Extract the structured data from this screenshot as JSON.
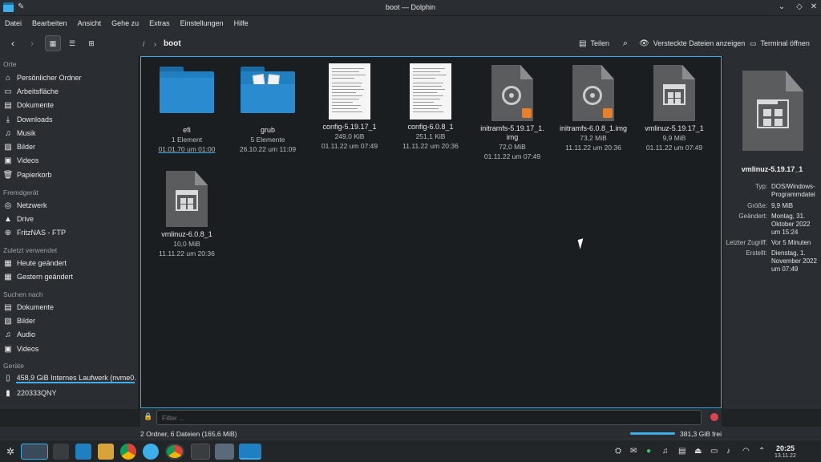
{
  "window": {
    "title": "boot — Dolphin"
  },
  "menu": [
    "Datei",
    "Bearbeiten",
    "Ansicht",
    "Gehe zu",
    "Extras",
    "Einstellungen",
    "Hilfe"
  ],
  "toolbar": {
    "breadcrumb_root": "/",
    "breadcrumb_current": "boot",
    "share_label": "Teilen",
    "hidden_files_label": "Versteckte Dateien anzeigen",
    "terminal_label": "Terminal öffnen"
  },
  "sidebar": {
    "sections": [
      {
        "title": "Orte",
        "items": [
          {
            "icon": "home-icon",
            "label": "Persönlicher Ordner"
          },
          {
            "icon": "desktop-icon",
            "label": "Arbeitsfläche"
          },
          {
            "icon": "documents-icon",
            "label": "Dokumente"
          },
          {
            "icon": "downloads-icon",
            "label": "Downloads"
          },
          {
            "icon": "music-icon",
            "label": "Musik"
          },
          {
            "icon": "pictures-icon",
            "label": "Bilder"
          },
          {
            "icon": "videos-icon",
            "label": "Videos"
          },
          {
            "icon": "trash-icon",
            "label": "Papierkorb"
          }
        ]
      },
      {
        "title": "Fremdgerät",
        "items": [
          {
            "icon": "network-icon",
            "label": "Netzwerk"
          },
          {
            "icon": "drive-icon",
            "label": "Drive"
          },
          {
            "icon": "ftp-icon",
            "label": "FritzNAS - FTP"
          }
        ]
      },
      {
        "title": "Zuletzt verwendet",
        "items": [
          {
            "icon": "recent-icon",
            "label": "Heute geändert"
          },
          {
            "icon": "recent-icon",
            "label": "Gestern geändert"
          }
        ]
      },
      {
        "title": "Suchen nach",
        "items": [
          {
            "icon": "documents-icon",
            "label": "Dokumente"
          },
          {
            "icon": "pictures-icon",
            "label": "Bilder"
          },
          {
            "icon": "audio-icon",
            "label": "Audio"
          },
          {
            "icon": "videos-icon",
            "label": "Videos"
          }
        ]
      },
      {
        "title": "Geräte",
        "items": [
          {
            "icon": "harddisk-icon",
            "label": "458,9 GiB Internes Laufwerk (nvme0..."
          },
          {
            "icon": "phone-icon",
            "label": "220333QNY"
          }
        ]
      }
    ]
  },
  "files": [
    {
      "name": "efi",
      "line1": "1 Element",
      "line2": "01.01.70 um 01:00",
      "kind": "folder"
    },
    {
      "name": "grub",
      "line1": "5 Elemente",
      "line2": "26.10.22 um 11:09",
      "kind": "folder-docs"
    },
    {
      "name": "config-5.19.17_1",
      "line1": "249,0 KiB",
      "line2": "01.11.22 um 07:49",
      "kind": "text"
    },
    {
      "name": "config-6.0.8_1",
      "line1": "251,1 KiB",
      "line2": "11.11.22 um 20:36",
      "kind": "text"
    },
    {
      "name": "initramfs-5.19.17_1.",
      "name2": "img",
      "line1": "72,0 MiB",
      "line2": "01.11.22 um 07:49",
      "kind": "disc"
    },
    {
      "name": "initramfs-6.0.8_1.img",
      "line1": "73,2 MiB",
      "line2": "11.11.22 um 20:36",
      "kind": "disc"
    },
    {
      "name": "vmlinuz-5.19.17_1",
      "line1": "9,9 MiB",
      "line2": "01.11.22 um 07:49",
      "kind": "exe"
    },
    {
      "name": "vmlinuz-6.0.8_1",
      "line1": "10,0 MiB",
      "line2": "11.11.22 um 20:36",
      "kind": "exe"
    }
  ],
  "info": {
    "title": "vmlinuz-5.19.17_1",
    "rows": [
      {
        "k": "Typ:",
        "v": "DOS/Windows-Programmdatei"
      },
      {
        "k": "Größe:",
        "v": "9,9 MiB"
      },
      {
        "k": "Geändert:",
        "v": "Montag, 31. Oktober 2022 um 15:24"
      },
      {
        "k": "Letzter Zugriff:",
        "v": "Vor 5 Minuten"
      },
      {
        "k": "Erstellt:",
        "v": "Dienstag, 1. November 2022 um 07:49"
      }
    ]
  },
  "filter": {
    "placeholder": "Filter ..."
  },
  "status": {
    "summary": "2 Ordner, 6 Dateien (165,6 MiB)",
    "free": "381,3 GiB frei"
  },
  "clock": {
    "time": "20:25",
    "date": "13.11.22"
  },
  "colors": {
    "accent": "#3daee9",
    "folder": "#1f7fc0",
    "background": "#1b1e20",
    "panel": "#2a2e32"
  }
}
